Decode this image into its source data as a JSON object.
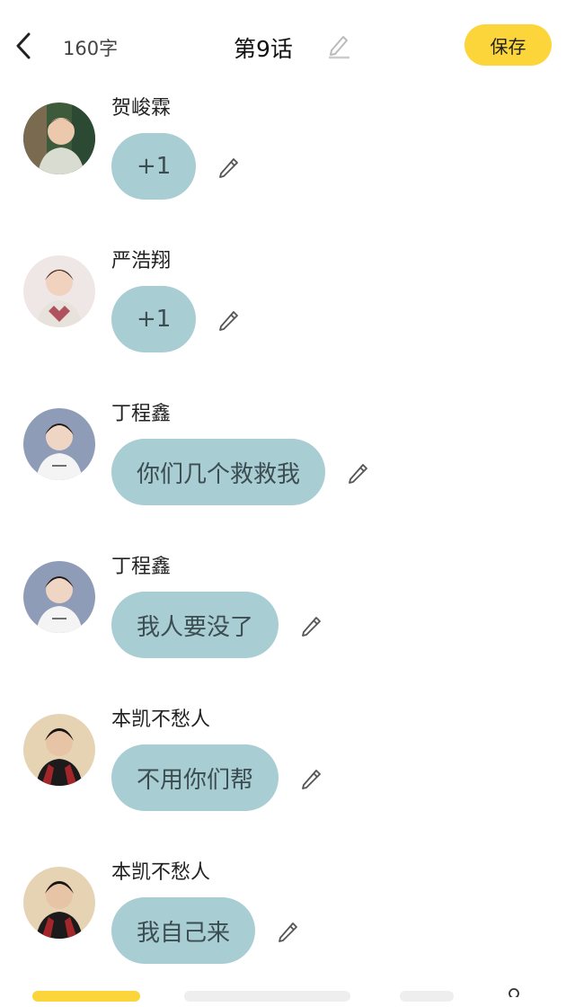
{
  "header": {
    "word_count": "160字",
    "chapter_title": "第9话",
    "save_label": "保存"
  },
  "colors": {
    "accent": "#fcd53a",
    "bubble": "#a8cdd3",
    "bubble_text": "#3c4d52"
  },
  "messages": [
    {
      "sender": "贺峻霖",
      "text": "+1",
      "avatar_icon": "avatar-icon"
    },
    {
      "sender": "严浩翔",
      "text": "+1",
      "avatar_icon": "avatar-icon"
    },
    {
      "sender": "丁程鑫",
      "text": "你们几个救救我",
      "avatar_icon": "avatar-icon"
    },
    {
      "sender": "丁程鑫",
      "text": "我人要没了",
      "avatar_icon": "avatar-icon"
    },
    {
      "sender": "本凯不愁人",
      "text": "不用你们帮",
      "avatar_icon": "avatar-icon"
    },
    {
      "sender": "本凯不愁人",
      "text": "我自己来",
      "avatar_icon": "avatar-icon"
    }
  ]
}
